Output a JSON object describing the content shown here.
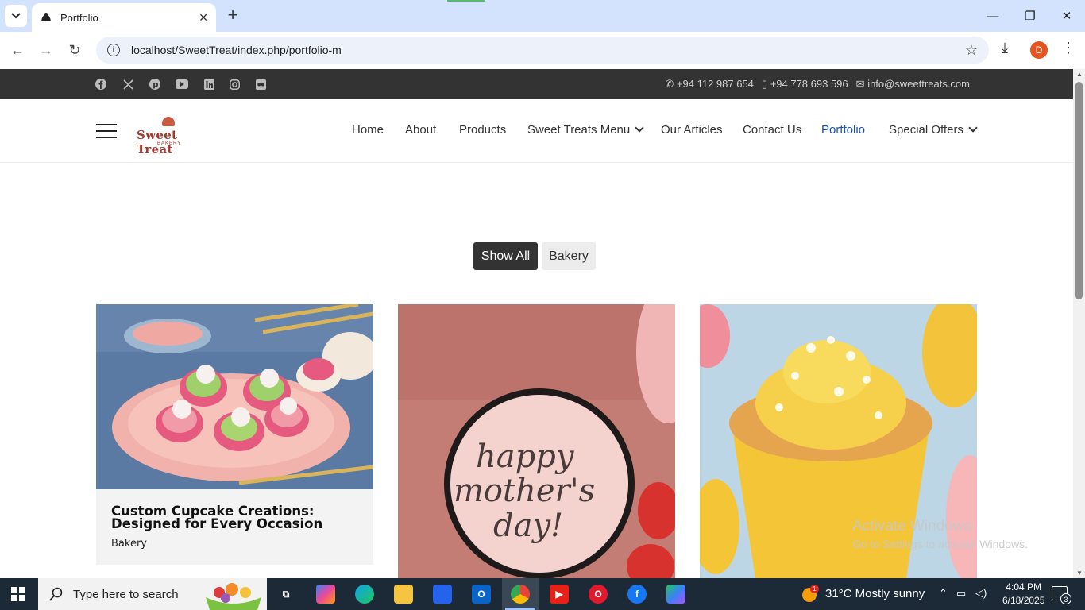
{
  "browser": {
    "tab_title": "Portfolio",
    "url": "localhost/SweetTreat/index.php/portfolio-m",
    "profile_initial": "D"
  },
  "topbar": {
    "phone1": "+94 112 987 654",
    "phone2": "+94 778 693 596",
    "email": "info@sweettreats.com",
    "socials": [
      "facebook-icon",
      "x-icon",
      "pinterest-icon",
      "youtube-icon",
      "linkedin-icon",
      "instagram-icon",
      "flickr-icon"
    ]
  },
  "logo": {
    "text": "Sweet Treat",
    "sub": "BAKERY"
  },
  "nav": {
    "home": "Home",
    "about": "About",
    "products": "Products",
    "sweet_treats_menu": "Sweet Treats Menu",
    "our_articles": "Our Articles",
    "contact_us": "Contact Us",
    "portfolio": "Portfolio",
    "special_offers": "Special Offers"
  },
  "filters": {
    "show_all": "Show All",
    "bakery": "Bakery"
  },
  "cards": [
    {
      "title": "Custom Cupcake Creations: Designed for Every Occasion",
      "category": "Bakery",
      "image": "cupcakes-on-pink-plate"
    },
    {
      "title": "",
      "category": "",
      "image": "happy-mothers-day-cupcake",
      "image_text": "happy mother's day!"
    },
    {
      "title": "",
      "category": "",
      "image": "yellow-frosted-cupcake"
    }
  ],
  "watermark": {
    "line1": "Activate Windows",
    "line2": "Go to Settings to activate Windows."
  },
  "taskbar": {
    "search_placeholder": "Type here to search",
    "weather": "31°C  Mostly sunny",
    "weather_badge": "1",
    "time": "4:04 PM",
    "date": "6/18/2025",
    "notification_count": "3"
  }
}
